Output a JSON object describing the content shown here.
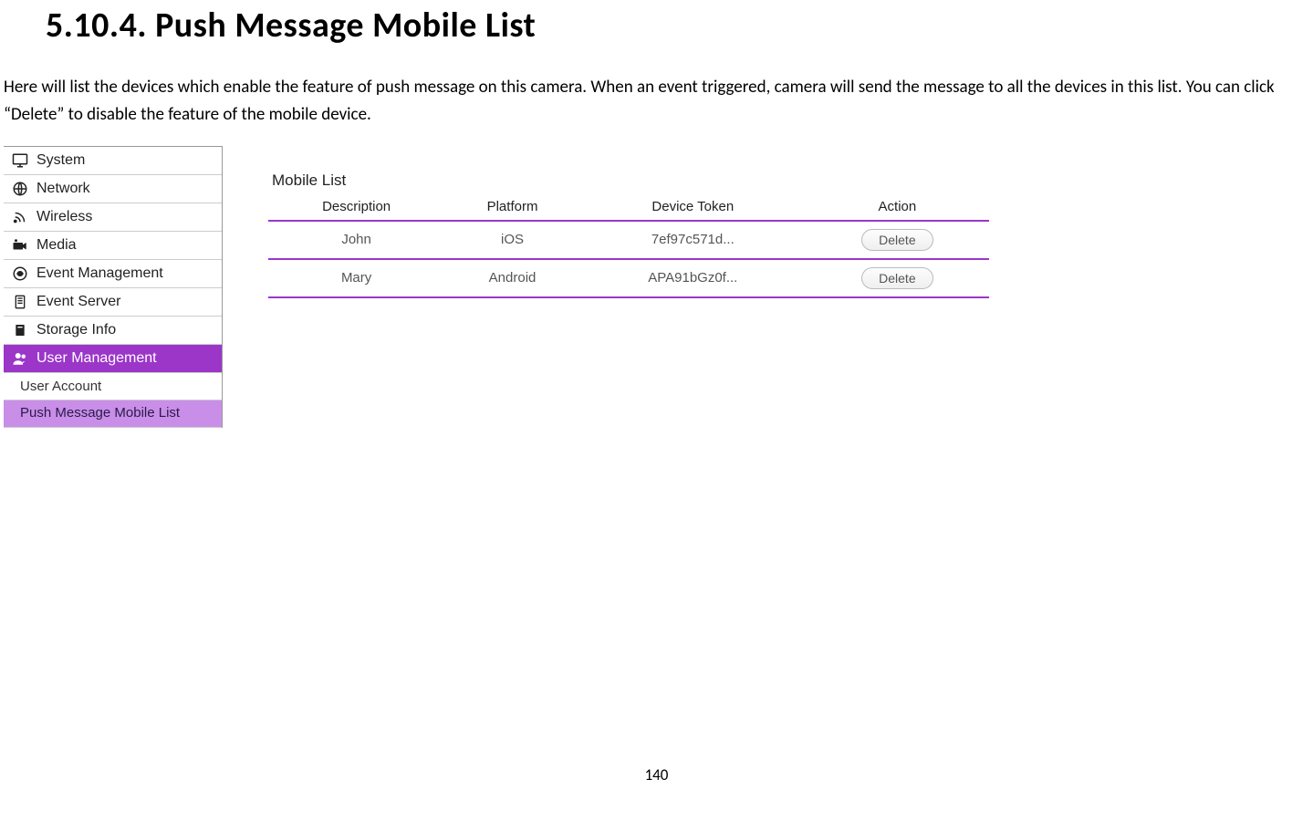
{
  "heading": "5.10.4. Push Message Mobile List",
  "intro": "Here will list the devices which enable the feature of push message on this camera. When an event triggered, camera will send the message to all the devices in this list. You can click “Delete” to disable the feature of the mobile device.",
  "sidebar": {
    "items": [
      {
        "label": "System",
        "icon": "monitor-icon"
      },
      {
        "label": "Network",
        "icon": "globe-icon"
      },
      {
        "label": "Wireless",
        "icon": "signal-icon"
      },
      {
        "label": "Media",
        "icon": "camera-icon"
      },
      {
        "label": "Event Management",
        "icon": "eye-icon"
      },
      {
        "label": "Event Server",
        "icon": "server-icon"
      },
      {
        "label": "Storage Info",
        "icon": "storage-icon"
      },
      {
        "label": "User Management",
        "icon": "user-icon",
        "active": true
      }
    ],
    "sub_items": [
      {
        "label": "User Account"
      },
      {
        "label": "Push Message Mobile List",
        "selected": true
      }
    ]
  },
  "panel": {
    "title": "Mobile List",
    "columns": [
      "Description",
      "Platform",
      "Device Token",
      "Action"
    ],
    "rows": [
      {
        "description": "John",
        "platform": "iOS",
        "token": "7ef97c571d...",
        "action": "Delete"
      },
      {
        "description": "Mary",
        "platform": "Android",
        "token": "APA91bGz0f...",
        "action": "Delete"
      }
    ]
  },
  "page_number": "140"
}
